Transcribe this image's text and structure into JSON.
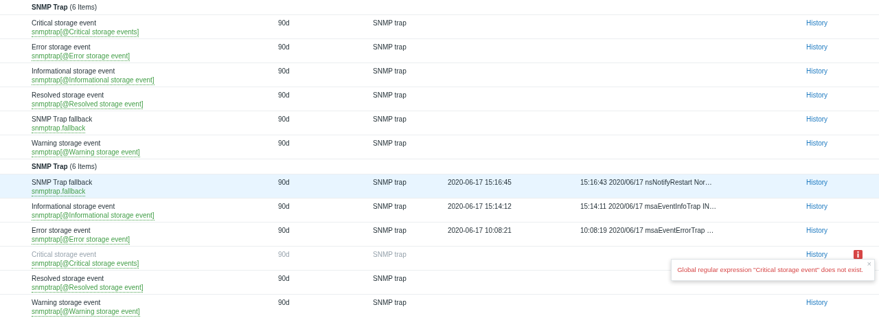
{
  "groups": [
    {
      "title": "SNMP Trap",
      "count": "(6 Items)",
      "rows": [
        {
          "name": "Critical storage event",
          "key": "snmptrap[@Critical storage events]",
          "history": "90d",
          "type": "SNMP trap",
          "selected": false,
          "disabled": false,
          "link": "History"
        },
        {
          "name": "Error storage event",
          "key": "snmptrap[@Error storage event]",
          "history": "90d",
          "type": "SNMP trap",
          "selected": false,
          "disabled": false,
          "link": "History"
        },
        {
          "name": "Informational storage event",
          "key": "snmptrap[@Informational storage event]",
          "history": "90d",
          "type": "SNMP trap",
          "selected": false,
          "disabled": false,
          "link": "History"
        },
        {
          "name": "Resolved storage event",
          "key": "snmptrap[@Resolved storage event]",
          "history": "90d",
          "type": "SNMP trap",
          "selected": false,
          "disabled": false,
          "link": "History"
        },
        {
          "name": "SNMP Trap fallback",
          "key": "snmptrap.fallback",
          "history": "90d",
          "type": "SNMP trap",
          "selected": false,
          "disabled": false,
          "link": "History"
        },
        {
          "name": "Warning storage event",
          "key": "snmptrap[@Warning storage event]",
          "history": "90d",
          "type": "SNMP trap",
          "selected": false,
          "disabled": false,
          "link": "History"
        }
      ]
    },
    {
      "title": "SNMP Trap",
      "count": "(6 Items)",
      "rows": [
        {
          "name": "SNMP Trap fallback",
          "key": "snmptrap.fallback",
          "history": "90d",
          "type": "SNMP trap",
          "last_check": "2020-06-17 15:16:45",
          "last_value": "15:16:43 2020/06/17 nsNotifyRestart Nor…",
          "selected": true,
          "disabled": false,
          "link": "History"
        },
        {
          "name": "Informational storage event",
          "key": "snmptrap[@Informational storage event]",
          "history": "90d",
          "type": "SNMP trap",
          "last_check": "2020-06-17 15:14:12",
          "last_value": "15:14:11 2020/06/17 msaEventInfoTrap IN…",
          "selected": false,
          "disabled": false,
          "link": "History"
        },
        {
          "name": "Error storage event",
          "key": "snmptrap[@Error storage event]",
          "history": "90d",
          "type": "SNMP trap",
          "last_check": "2020-06-17 10:08:21",
          "last_value": "10:08:19 2020/06/17 msaEventErrorTrap …",
          "selected": false,
          "disabled": false,
          "link": "History"
        },
        {
          "name": "Critical storage event",
          "key": "snmptrap[@Critical storage events]",
          "history": "90d",
          "type": "SNMP trap",
          "selected": false,
          "disabled": true,
          "link": "History",
          "error": {
            "message": "Global regular expression \"Critical storage event\" does not exist.",
            "close": "×"
          }
        },
        {
          "name": "Resolved storage event",
          "key": "snmptrap[@Resolved storage event]",
          "history": "90d",
          "type": "SNMP trap",
          "selected": false,
          "disabled": false
        },
        {
          "name": "Warning storage event",
          "key": "snmptrap[@Warning storage event]",
          "history": "90d",
          "type": "SNMP trap",
          "selected": false,
          "disabled": false,
          "link": "History"
        }
      ]
    }
  ]
}
